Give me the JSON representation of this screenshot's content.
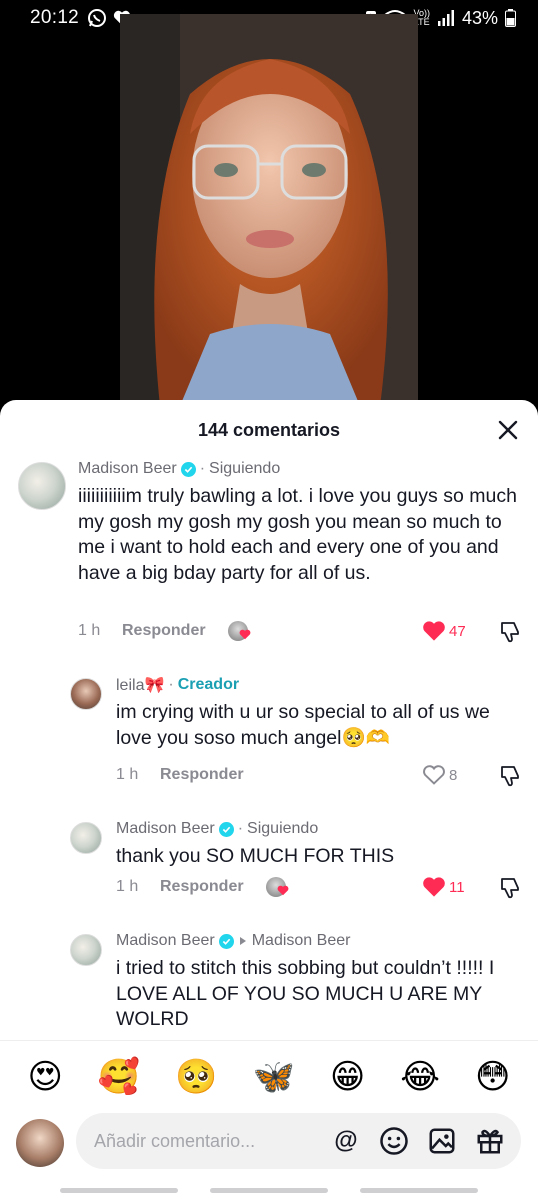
{
  "status_bar": {
    "time": "20:12",
    "network": "Vo))\nLTE",
    "battery": "43%"
  },
  "sheet": {
    "title": "144 comentarios"
  },
  "comments": [
    {
      "name": "Madison Beer",
      "tag": "Siguiendo",
      "text": "iiiiiiiiiiim truly bawling a lot. i love you guys so much my gosh my gosh my gosh you mean so much to me i want to hold each and every one of you and have a big bday party for all of us.",
      "time": "1 h",
      "reply": "Responder",
      "likes": "47"
    },
    {
      "name": "leila🎀",
      "tag": "Creador",
      "text": "im crying with u ur so special to all of us we love you soso much angel🥺🫶",
      "time": "1 h",
      "reply": "Responder",
      "likes": "8"
    },
    {
      "name": "Madison Beer",
      "tag": "Siguiendo",
      "text": "thank you SO MUCH FOR THIS",
      "time": "1 h",
      "reply": "Responder",
      "likes": "11"
    },
    {
      "name": "Madison Beer",
      "reply_to": "Madison Beer",
      "text": "i tried to stitch this sobbing but couldn’t !!!!! I LOVE ALL OF YOU SO MUCH U ARE MY WOLRD"
    }
  ],
  "emoji_bar": [
    "😍",
    "🥰",
    "🥺",
    "🦋",
    "😁",
    "😂",
    "😳"
  ],
  "input": {
    "placeholder": "Añadir comentario...",
    "mention_icon": "@"
  },
  "colors": {
    "like_red": "#fe2c55",
    "creator_teal": "#1a9fb3",
    "verified": "#20d5ec"
  }
}
